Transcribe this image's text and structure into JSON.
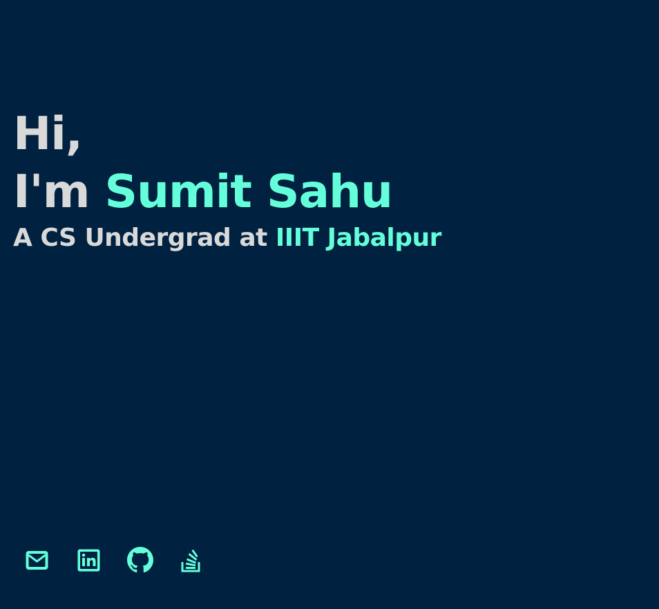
{
  "hero": {
    "greeting_line": "Hi,",
    "intro_prefix": "I'm ",
    "name": "Sumit Sahu",
    "subtitle_prefix": "A CS Undergrad at ",
    "institution": "IIIT Jabalpur"
  },
  "socials": [
    {
      "icon": "mail-icon"
    },
    {
      "icon": "linkedin-icon"
    },
    {
      "icon": "github-icon"
    },
    {
      "icon": "stackoverflow-icon"
    }
  ],
  "colors": {
    "background": "#002140",
    "text": "#d9d9d9",
    "accent": "#64ffda"
  }
}
